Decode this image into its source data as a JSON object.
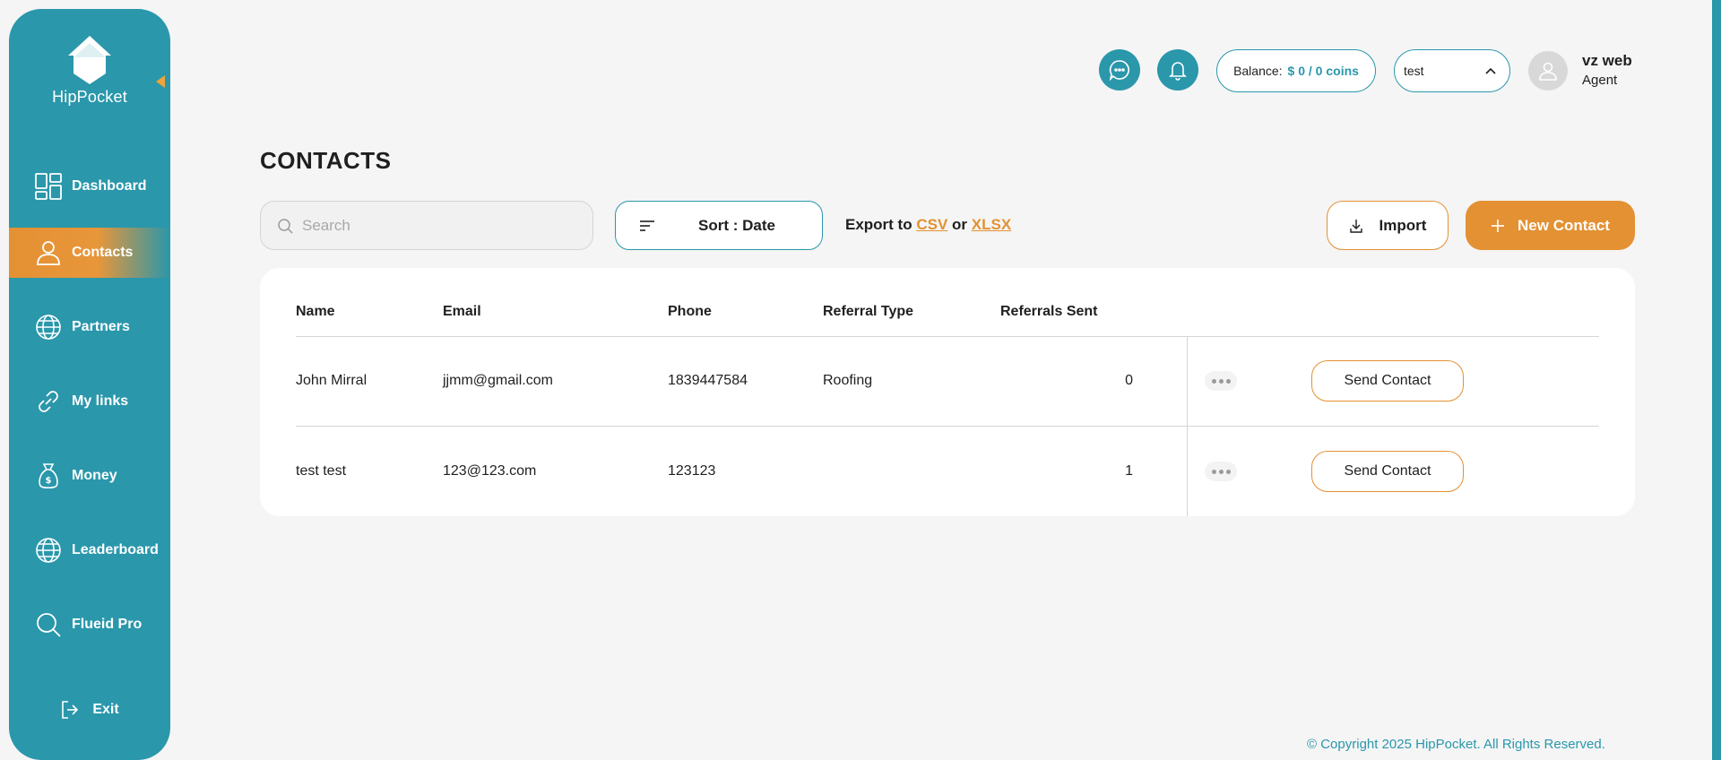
{
  "brand": {
    "name": "HipPocket"
  },
  "sidebar": {
    "items": [
      {
        "label": "Dashboard",
        "icon": "dashboard-icon"
      },
      {
        "label": "Contacts",
        "icon": "person-icon",
        "active": true
      },
      {
        "label": "Partners",
        "icon": "globe-icon"
      },
      {
        "label": "My links",
        "icon": "link-icon"
      },
      {
        "label": "Money",
        "icon": "money-bag-icon"
      },
      {
        "label": "Leaderboard",
        "icon": "globe-icon"
      },
      {
        "label": "Flueid Pro",
        "icon": "search-icon"
      }
    ],
    "exit_label": "Exit"
  },
  "header": {
    "balance_label": "Balance:",
    "balance_value": "$ 0 / 0 coins",
    "selector_value": "test",
    "user_name": "vz web",
    "user_role": "Agent"
  },
  "page": {
    "title": "CONTACTS"
  },
  "toolbar": {
    "search_placeholder": "Search",
    "sort_label": "Sort : Date",
    "export_prefix": "Export to",
    "export_csv": "CSV",
    "export_or": "or",
    "export_xlsx": "XLSX",
    "import_label": "Import",
    "new_contact_label": "New Contact"
  },
  "table": {
    "columns": [
      "Name",
      "Email",
      "Phone",
      "Referral Type",
      "Referrals Sent"
    ],
    "rows": [
      {
        "name": "John Mirral",
        "email": "jjmm@gmail.com",
        "phone": "1839447584",
        "referral_type": "Roofing",
        "referrals_sent": "0",
        "action": "Send Contact"
      },
      {
        "name": "test test",
        "email": "123@123.com",
        "phone": "123123",
        "referral_type": "",
        "referrals_sent": "1",
        "action": "Send Contact"
      }
    ]
  },
  "footer": {
    "copyright": "© Copyright 2025 HipPocket. All Rights Reserved."
  },
  "colors": {
    "primary": "#2a97ab",
    "accent": "#e39133",
    "background": "#f5f5f5"
  }
}
